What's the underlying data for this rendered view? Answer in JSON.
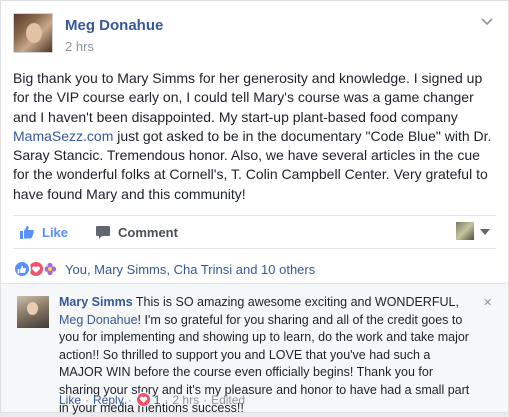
{
  "post": {
    "author": "Meg Donahue",
    "time": "2 hrs",
    "text_before_link": "Big thank you to Mary Simms for her generosity and knowledge. I signed up for the VIP course early on, I could tell Mary's course was a game changer and I haven't been disappointed. My start-up plant-based food company ",
    "link_text": "MamaSezz.com",
    "text_after_link": " just got asked to be in the documentary \"Code Blue\" with Dr. Saray Stancic. Tremendous honor. Also, we have several articles in the cue for the wonderful folks at Cornell's, T. Colin Campbell Center. Very grateful to have found Mary and this community!"
  },
  "actions": {
    "like_label": "Like",
    "comment_label": "Comment"
  },
  "reactions": {
    "summary": "You, Mary Simms, Cha Trinsi and 10 others"
  },
  "comment": {
    "author": "Mary Simms",
    "text_before_tag": " This is SO amazing awesome exciting and WONDERFUL, ",
    "tag": "Meg Donahue",
    "text_after_tag": "! I'm so grateful for you sharing and all of the credit goes to you for implementing and showing up to learn, do the work and take major action!! So thrilled to support you and LOVE that you've had such a MAJOR WIN before the course even officially begins! Thank you for sharing your story and it's my pleasure and honor to have had a small part in your media mentions success!!",
    "meta": {
      "like": "Like",
      "reply": "Reply",
      "reaction_count": "1",
      "time": "2 hrs",
      "edited": "Edited"
    },
    "close": "×"
  },
  "colors": {
    "link": "#365899",
    "like_blue": "#5890ff",
    "love_red": "#f25268",
    "muted": "#90949c"
  }
}
